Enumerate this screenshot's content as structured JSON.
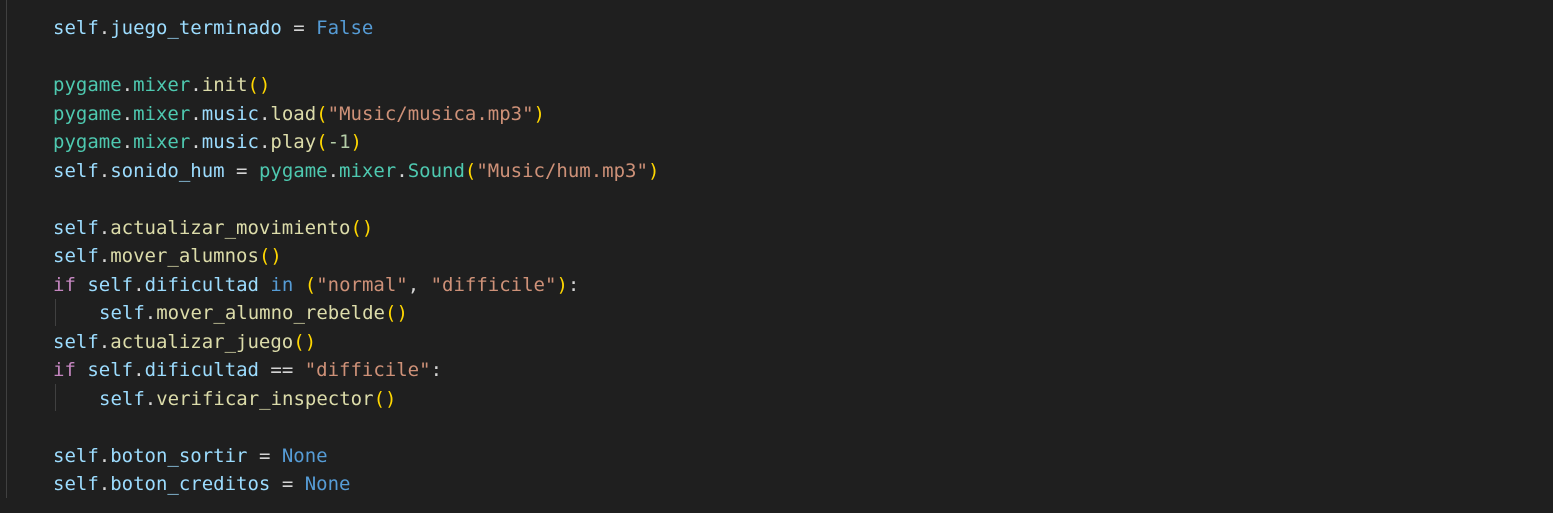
{
  "editor": {
    "lines": [
      {
        "tokens": [
          {
            "t": "self",
            "c": "kw-self"
          },
          {
            "t": ".",
            "c": "op"
          },
          {
            "t": "juego_terminado",
            "c": "attr"
          },
          {
            "t": " = ",
            "c": "op"
          },
          {
            "t": "False",
            "c": "const"
          }
        ]
      },
      {
        "tokens": []
      },
      {
        "tokens": [
          {
            "t": "pygame",
            "c": "mod"
          },
          {
            "t": ".",
            "c": "op"
          },
          {
            "t": "mixer",
            "c": "mod"
          },
          {
            "t": ".",
            "c": "op"
          },
          {
            "t": "init",
            "c": "fn"
          },
          {
            "t": "()",
            "c": "p1"
          }
        ]
      },
      {
        "tokens": [
          {
            "t": "pygame",
            "c": "mod"
          },
          {
            "t": ".",
            "c": "op"
          },
          {
            "t": "mixer",
            "c": "mod"
          },
          {
            "t": ".",
            "c": "op"
          },
          {
            "t": "music",
            "c": "attr"
          },
          {
            "t": ".",
            "c": "op"
          },
          {
            "t": "load",
            "c": "fn"
          },
          {
            "t": "(",
            "c": "p1"
          },
          {
            "t": "\"Music/musica.mp3\"",
            "c": "str"
          },
          {
            "t": ")",
            "c": "p1"
          }
        ]
      },
      {
        "tokens": [
          {
            "t": "pygame",
            "c": "mod"
          },
          {
            "t": ".",
            "c": "op"
          },
          {
            "t": "mixer",
            "c": "mod"
          },
          {
            "t": ".",
            "c": "op"
          },
          {
            "t": "music",
            "c": "attr"
          },
          {
            "t": ".",
            "c": "op"
          },
          {
            "t": "play",
            "c": "fn"
          },
          {
            "t": "(",
            "c": "p1"
          },
          {
            "t": "-1",
            "c": "num"
          },
          {
            "t": ")",
            "c": "p1"
          }
        ]
      },
      {
        "tokens": [
          {
            "t": "self",
            "c": "kw-self"
          },
          {
            "t": ".",
            "c": "op"
          },
          {
            "t": "sonido_hum",
            "c": "attr"
          },
          {
            "t": " = ",
            "c": "op"
          },
          {
            "t": "pygame",
            "c": "mod"
          },
          {
            "t": ".",
            "c": "op"
          },
          {
            "t": "mixer",
            "c": "mod"
          },
          {
            "t": ".",
            "c": "op"
          },
          {
            "t": "Sound",
            "c": "cls"
          },
          {
            "t": "(",
            "c": "p1"
          },
          {
            "t": "\"Music/hum.mp3\"",
            "c": "str"
          },
          {
            "t": ")",
            "c": "p1"
          }
        ]
      },
      {
        "tokens": []
      },
      {
        "tokens": [
          {
            "t": "self",
            "c": "kw-self"
          },
          {
            "t": ".",
            "c": "op"
          },
          {
            "t": "actualizar_movimiento",
            "c": "fn"
          },
          {
            "t": "()",
            "c": "p1"
          }
        ]
      },
      {
        "tokens": [
          {
            "t": "self",
            "c": "kw-self"
          },
          {
            "t": ".",
            "c": "op"
          },
          {
            "t": "mover_alumnos",
            "c": "fn"
          },
          {
            "t": "()",
            "c": "p1"
          }
        ]
      },
      {
        "tokens": [
          {
            "t": "if",
            "c": "ctrl"
          },
          {
            "t": " ",
            "c": "op"
          },
          {
            "t": "self",
            "c": "kw-self"
          },
          {
            "t": ".",
            "c": "op"
          },
          {
            "t": "dificultad",
            "c": "attr"
          },
          {
            "t": " ",
            "c": "op"
          },
          {
            "t": "in",
            "c": "const"
          },
          {
            "t": " ",
            "c": "op"
          },
          {
            "t": "(",
            "c": "p1"
          },
          {
            "t": "\"normal\"",
            "c": "str"
          },
          {
            "t": ", ",
            "c": "op"
          },
          {
            "t": "\"difficile\"",
            "c": "str"
          },
          {
            "t": ")",
            "c": "p1"
          },
          {
            "t": ":",
            "c": "op"
          }
        ]
      },
      {
        "indent": true,
        "tokens": [
          {
            "t": "self",
            "c": "kw-self"
          },
          {
            "t": ".",
            "c": "op"
          },
          {
            "t": "mover_alumno_rebelde",
            "c": "fn"
          },
          {
            "t": "()",
            "c": "p1"
          }
        ]
      },
      {
        "tokens": [
          {
            "t": "self",
            "c": "kw-self"
          },
          {
            "t": ".",
            "c": "op"
          },
          {
            "t": "actualizar_juego",
            "c": "fn"
          },
          {
            "t": "()",
            "c": "p1"
          }
        ]
      },
      {
        "tokens": [
          {
            "t": "if",
            "c": "ctrl"
          },
          {
            "t": " ",
            "c": "op"
          },
          {
            "t": "self",
            "c": "kw-self"
          },
          {
            "t": ".",
            "c": "op"
          },
          {
            "t": "dificultad",
            "c": "attr"
          },
          {
            "t": " == ",
            "c": "op"
          },
          {
            "t": "\"difficile\"",
            "c": "str"
          },
          {
            "t": ":",
            "c": "op"
          }
        ]
      },
      {
        "indent": true,
        "tokens": [
          {
            "t": "self",
            "c": "kw-self"
          },
          {
            "t": ".",
            "c": "op"
          },
          {
            "t": "verificar_inspector",
            "c": "fn"
          },
          {
            "t": "()",
            "c": "p1"
          }
        ]
      },
      {
        "tokens": []
      },
      {
        "tokens": [
          {
            "t": "self",
            "c": "kw-self"
          },
          {
            "t": ".",
            "c": "op"
          },
          {
            "t": "boton_sortir",
            "c": "attr"
          },
          {
            "t": " = ",
            "c": "op"
          },
          {
            "t": "None",
            "c": "const"
          }
        ]
      },
      {
        "tokens": [
          {
            "t": "self",
            "c": "kw-self"
          },
          {
            "t": ".",
            "c": "op"
          },
          {
            "t": "boton_creditos",
            "c": "attr"
          },
          {
            "t": " = ",
            "c": "op"
          },
          {
            "t": "None",
            "c": "const"
          }
        ]
      }
    ]
  }
}
